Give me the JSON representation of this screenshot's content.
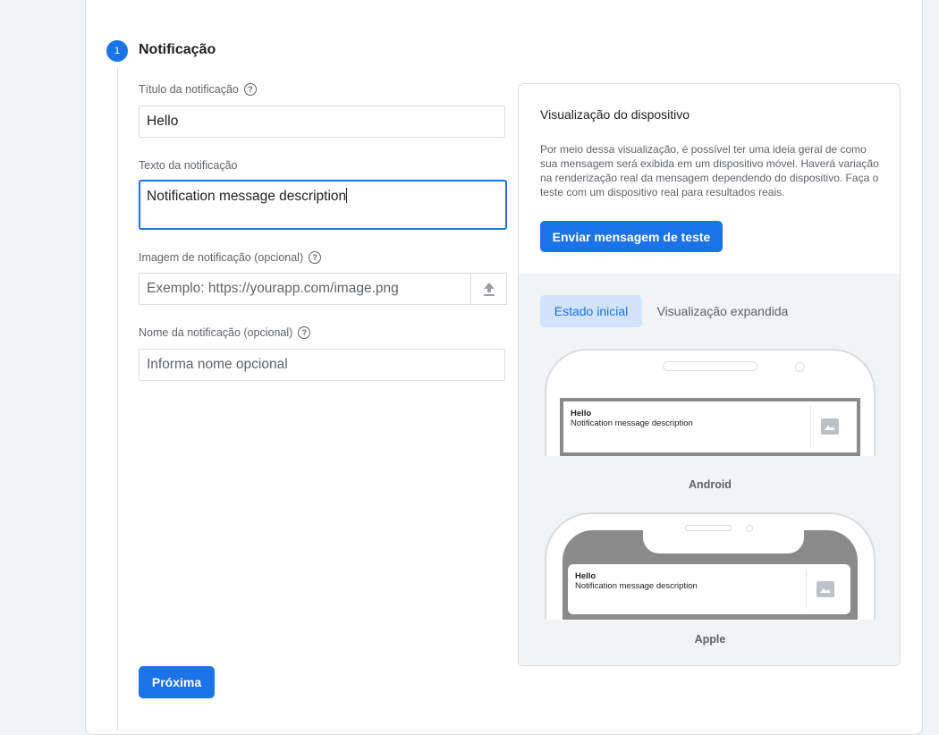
{
  "step": {
    "number": "1",
    "title": "Notificação"
  },
  "form": {
    "title_label": "Título da notificação",
    "title_value": "Hello",
    "text_label": "Texto da notificação",
    "text_value": "Notification message description",
    "image_label": "Imagem de notificação (opcional)",
    "image_placeholder": "Exemplo: https://yourapp.com/image.png",
    "name_label": "Nome da notificação (opcional)",
    "name_placeholder": "Informa nome opcional",
    "help_glyph": "?",
    "next_button": "Próxima"
  },
  "preview": {
    "title": "Visualização do dispositivo",
    "description": "Por meio dessa visualização, é possível ter uma ideia geral de como sua mensagem será exibida em um dispositivo móvel. Haverá variação na renderização real da mensagem dependendo do dispositivo. Faça o teste com um dispositivo real para resultados reais.",
    "send_test_button": "Enviar mensagem de teste",
    "tabs": [
      {
        "label": "Estado inicial",
        "active": true
      },
      {
        "label": "Visualização expandida",
        "active": false
      }
    ],
    "notification_title": "Hello",
    "notification_body": "Notification message description",
    "android_label": "Android",
    "apple_label": "Apple"
  },
  "colors": {
    "accent": "#1a73e8",
    "tab_active_bg": "#d2e3fc",
    "page_bg": "#f1f3f4"
  },
  "icons": {
    "help": "help-circle-icon",
    "upload": "upload-icon",
    "image": "image-placeholder-icon"
  }
}
